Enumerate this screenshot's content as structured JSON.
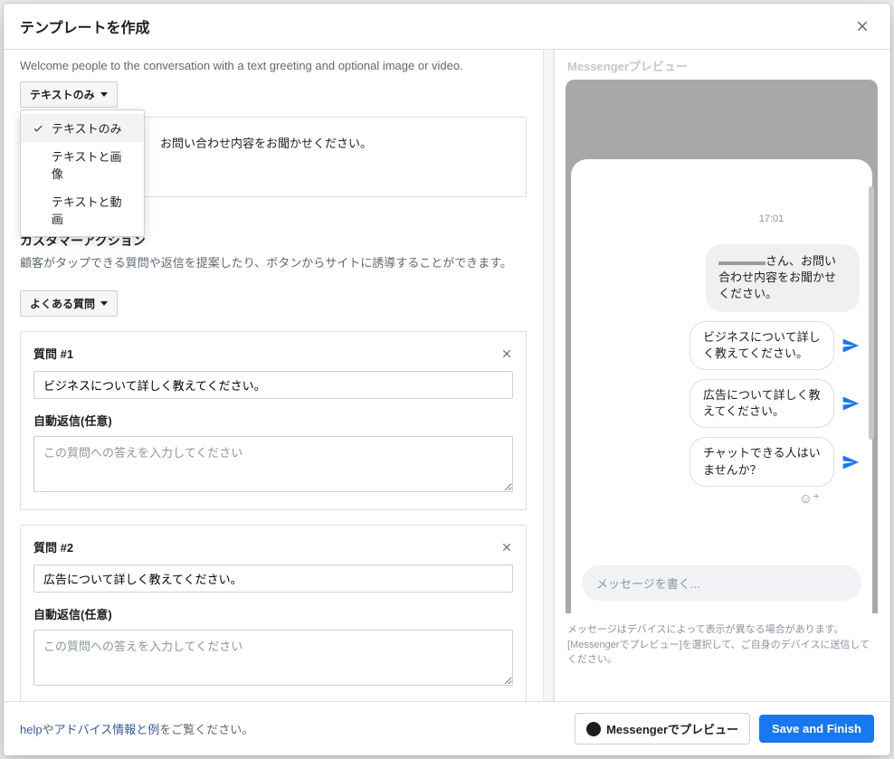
{
  "modal": {
    "title": "テンプレートを作成"
  },
  "greeting": {
    "description": "Welcome people to the conversation with a text greeting and optional image or video.",
    "dropdown_label": "テキストのみ",
    "dropdown_options": {
      "text_only": "テキストのみ",
      "text_image": "テキストと画像",
      "text_video": "テキストと動画"
    },
    "card_text": "お問い合わせ内容をお聞かせください。"
  },
  "customer_action": {
    "title": "カスタマーアクション",
    "description": "顧客がタップできる質問や返信を提案したり、ボタンからサイトに誘導することができます。",
    "dropdown_label": "よくある質問"
  },
  "questions": {
    "auto_reply_label": "自動返信(任意)",
    "auto_reply_placeholder": "この質問への答えを入力してください",
    "q1": {
      "label": "質問 #1",
      "value": "ビジネスについて詳しく教えてください。"
    },
    "q2": {
      "label": "質問 #2",
      "value": "広告について詳しく教えてください。"
    }
  },
  "preview": {
    "heading": "Messengerプレビュー",
    "time": "17:01",
    "greeting_prefix": "さん、お問い合わせ内容をお聞かせください。",
    "suggestions": {
      "s1": "ビジネスについて詳しく教えてください。",
      "s2": "広告について詳しく教えてください。",
      "s3": "チャットできる人はいませんか？"
    },
    "reaction_icon": "☺⁺",
    "input_placeholder": "メッセージを書く...",
    "disclaimer": "メッセージはデバイスによって表示が異なる場合があります。[Messengerでプレビュー]を選択して、ご自身のデバイスに送信してください。"
  },
  "footer": {
    "help_link": "help",
    "ya": "や",
    "advice_link": "アドバイス情報と例",
    "suffix": "をご覧ください。",
    "preview_btn": "Messengerでプレビュー",
    "save_btn": "Save and Finish"
  }
}
